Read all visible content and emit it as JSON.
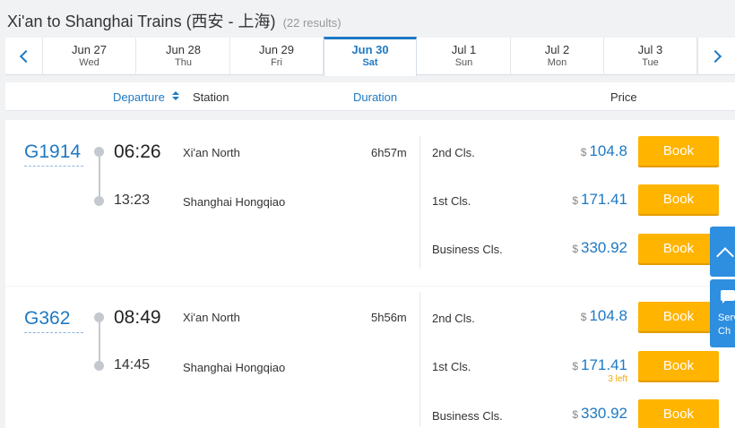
{
  "header": {
    "title": "Xi'an to Shanghai Trains (西安 - 上海)",
    "results": "(22 results)"
  },
  "dates": [
    {
      "date": "Jun 27",
      "weekday": "Wed"
    },
    {
      "date": "Jun 28",
      "weekday": "Thu"
    },
    {
      "date": "Jun 29",
      "weekday": "Fri"
    },
    {
      "date": "Jun 30",
      "weekday": "Sat"
    },
    {
      "date": "Jul 1",
      "weekday": "Sun"
    },
    {
      "date": "Jul 2",
      "weekday": "Mon"
    },
    {
      "date": "Jul 3",
      "weekday": "Tue"
    }
  ],
  "selected_date_index": 3,
  "columns": {
    "departure": "Departure",
    "station": "Station",
    "duration": "Duration",
    "price": "Price"
  },
  "trains": [
    {
      "number": "G1914",
      "depart_time": "06:26",
      "arrive_time": "13:23",
      "from_station": "Xi'an North",
      "to_station": "Shanghai Hongqiao",
      "duration": "6h57m",
      "seats": [
        {
          "class": "2nd Cls.",
          "currency": "$",
          "price": "104.8",
          "button": "Book",
          "note": ""
        },
        {
          "class": "1st Cls.",
          "currency": "$",
          "price": "171.41",
          "button": "Book",
          "note": ""
        },
        {
          "class": "Business Cls.",
          "currency": "$",
          "price": "330.92",
          "button": "Book",
          "note": ""
        }
      ]
    },
    {
      "number": "G362",
      "depart_time": "08:49",
      "arrive_time": "14:45",
      "from_station": "Xi'an North",
      "to_station": "Shanghai Hongqiao",
      "duration": "5h56m",
      "seats": [
        {
          "class": "2nd Cls.",
          "currency": "$",
          "price": "104.8",
          "button": "Book",
          "note": ""
        },
        {
          "class": "1st Cls.",
          "currency": "$",
          "price": "171.41",
          "button": "Book",
          "note": "3 left"
        },
        {
          "class": "Business Cls.",
          "currency": "$",
          "price": "330.92",
          "button": "Book",
          "note": ""
        }
      ]
    }
  ],
  "side": {
    "service_label_line1": "Serv",
    "service_label_line2": "Ch"
  },
  "colors": {
    "accent": "#1e79c4",
    "book_button": "#ffb400",
    "side_tab": "#2e8ee0",
    "left_note": "#f2a800"
  }
}
